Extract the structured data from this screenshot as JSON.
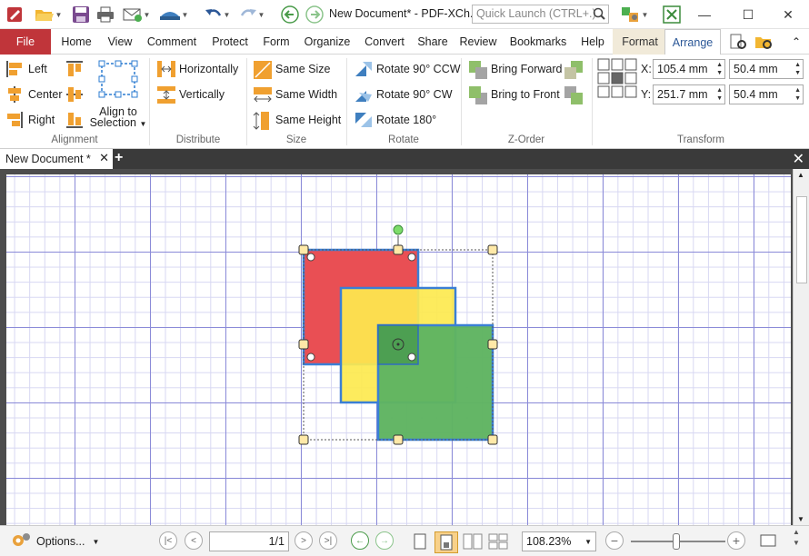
{
  "titlebar": {
    "document_title": "New Document* - PDF-XCh..",
    "quick_launch_placeholder": "Quick Launch (CTRL+.)"
  },
  "menu": {
    "file": "File",
    "tabs": [
      "Home",
      "View",
      "Comment",
      "Protect",
      "Form",
      "Organize",
      "Convert",
      "Share",
      "Review",
      "Bookmarks",
      "Help"
    ],
    "format": "Format",
    "arrange": "Arrange"
  },
  "ribbon": {
    "alignment": {
      "left": "Left",
      "center": "Center",
      "right": "Right",
      "align_to_selection_1": "Align to",
      "align_to_selection_2": "Selection",
      "group": "Alignment"
    },
    "distribute": {
      "horizontally": "Horizontally",
      "vertically": "Vertically",
      "group": "Distribute"
    },
    "size": {
      "same_size": "Same Size",
      "same_width": "Same Width",
      "same_height": "Same Height",
      "group": "Size"
    },
    "rotate": {
      "ccw": "Rotate 90° CCW",
      "cw": "Rotate 90° CW",
      "r180": "Rotate 180°",
      "group": "Rotate"
    },
    "zorder": {
      "forward": "Bring Forward",
      "front": "Bring to Front",
      "group": "Z-Order"
    },
    "transform": {
      "x_label": "X:",
      "x_value": "105.4 mm",
      "w_value": "50.4 mm",
      "y_label": "Y:",
      "y_value": "251.7 mm",
      "h_value": "50.4 mm",
      "group": "Transform"
    }
  },
  "document_tab": {
    "label": "New Document *"
  },
  "statusbar": {
    "options": "Options...",
    "page_indicator": "1/1",
    "zoom": "108.23%"
  },
  "colors": {
    "file_tab": "#c0353a",
    "red_square": "#e94f54",
    "yellow_square": "#fde94f",
    "green_square": "#5fb461",
    "selection_blue": "#3a7fd5",
    "grid_major": "#8b8bd8",
    "grid_minor": "#d7d7f2"
  }
}
